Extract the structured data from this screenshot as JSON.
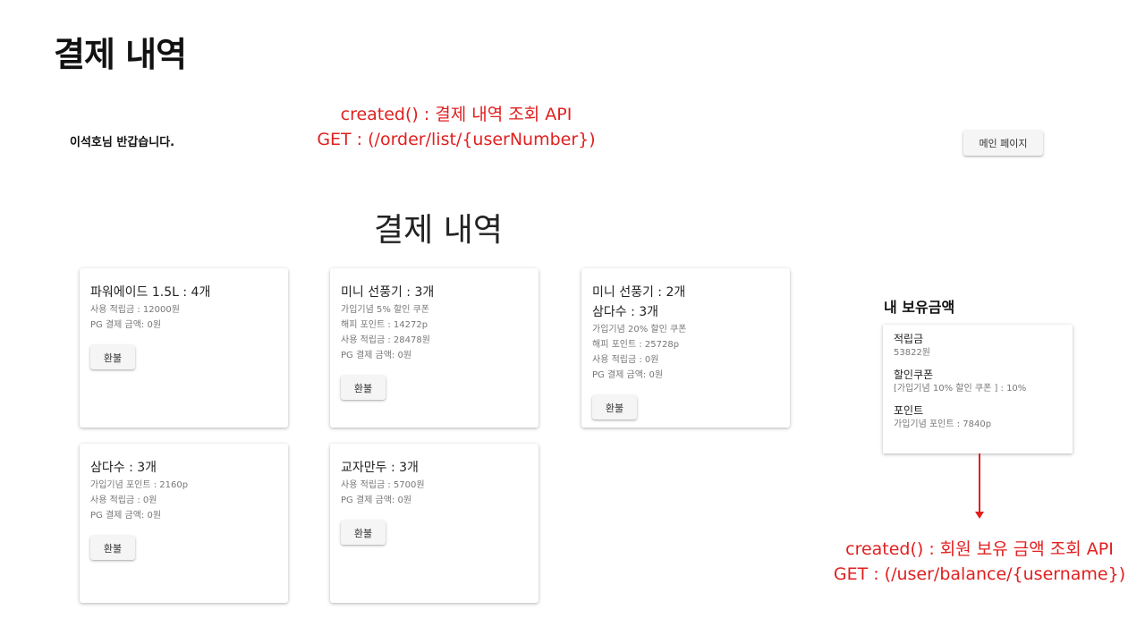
{
  "slide_title": "결제 내역",
  "annotations": {
    "top": [
      "created() :  결제 내역 조회 API",
      "GET : (/order/list/{userNumber})"
    ],
    "bottom": [
      "created() : 회원 보유 금액 조회 API",
      "GET : (/user/balance/{username})"
    ]
  },
  "header": {
    "greeting": "이석호님 반갑습니다.",
    "main_page_button": "메인 페이지"
  },
  "page_heading": "결제 내역",
  "refund_label": "환불",
  "orders": [
    {
      "titles": [
        "파워에이드 1.5L : 4개"
      ],
      "details": [
        "사용 적립금 : 12000원",
        "PG 결제 금액: 0원"
      ]
    },
    {
      "titles": [
        "미니 선풍기 : 3개"
      ],
      "details": [
        "가입기념 5% 할인 쿠폰",
        "해피 포인트 : 14272p",
        "사용 적립금 : 28478원",
        "PG 결제 금액: 0원"
      ]
    },
    {
      "titles": [
        "미니 선풍기 : 2개",
        "삼다수 : 3개"
      ],
      "details": [
        "가입기념 20% 할인 쿠폰",
        "해피 포인트 : 25728p",
        "사용 적립금 : 0원",
        "PG 결제 금액: 0원"
      ]
    },
    {
      "titles": [
        "삼다수 : 3개"
      ],
      "details": [
        "가입기념 포인트 : 2160p",
        "사용 적립금 : 0원",
        "PG 결제 금액: 0원"
      ]
    },
    {
      "titles": [
        "교자만두 : 3개"
      ],
      "details": [
        "사용 적립금 : 5700원",
        "PG 결제 금액: 0원"
      ]
    }
  ],
  "balance": {
    "title": "내 보유금액",
    "sections": [
      {
        "label": "적립금",
        "value": "53822원"
      },
      {
        "label": "할인쿠폰",
        "value": "[가입기념 10% 할인 쿠폰 ] : 10%"
      },
      {
        "label": "포인트",
        "value": "가입기념 포인트 : 7840p"
      }
    ]
  },
  "colors": {
    "annotation": "#e02020",
    "text_primary": "#222222",
    "text_secondary": "#777777"
  }
}
